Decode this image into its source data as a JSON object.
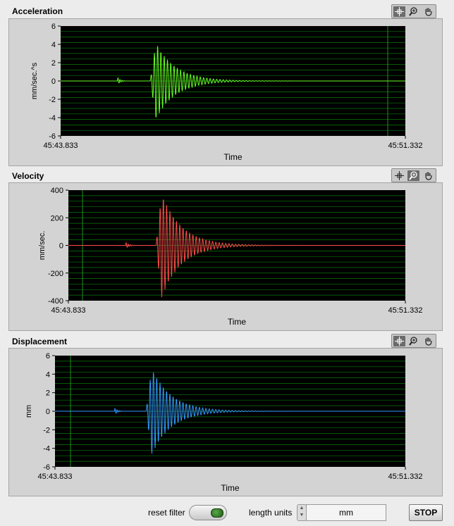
{
  "charts": [
    {
      "title": "Acceleration",
      "ylabel": "mm/sec.^s",
      "xlabel": "Time",
      "x_start": "45:43.833",
      "x_end": "45:51.332",
      "y_ticks": [
        "6",
        "4",
        "2",
        "0",
        "-2",
        "-4",
        "-6"
      ],
      "trace_color": "#66ff22",
      "cursor": true,
      "toolbar_active": "cursor-tool"
    },
    {
      "title": "Velocity",
      "ylabel": "mm/sec.",
      "xlabel": "Time",
      "x_start": "45:43.833",
      "x_end": "45:51.332",
      "y_ticks": [
        "400",
        "200",
        "0",
        "-200",
        "-400"
      ],
      "trace_color": "#ff4a4a",
      "cursor": true,
      "toolbar_active": "zoom-tool"
    },
    {
      "title": "Displacement",
      "ylabel": "mm",
      "xlabel": "Time",
      "x_start": "45:43.833",
      "x_end": "45:51.332",
      "y_ticks": [
        "6",
        "4",
        "2",
        "0",
        "-2",
        "-4",
        "-6"
      ],
      "trace_color": "#3399ff",
      "cursor": true,
      "toolbar_active": "cursor-tool"
    }
  ],
  "controls": {
    "reset_filter_label": "reset filter",
    "length_units_label": "length units",
    "length_units_value": "mm",
    "stop_label": "STOP"
  },
  "chart_data": [
    {
      "type": "line",
      "title": "Acceleration",
      "xlabel": "Time",
      "ylabel": "mm/sec.^s",
      "x_range": [
        "45:43.833",
        "45:51.332"
      ],
      "ylim": [
        -6,
        6
      ],
      "series": [
        {
          "values_description_peak": 4.2,
          "trough": -5.0
        }
      ]
    },
    {
      "type": "line",
      "title": "Velocity",
      "xlabel": "Time",
      "ylabel": "mm/sec.",
      "x_range": [
        "45:43.833",
        "45:51.332"
      ],
      "ylim": [
        -400,
        400
      ],
      "series": [
        {
          "values_description_peak": 380,
          "trough": -340
        }
      ]
    },
    {
      "type": "line",
      "title": "Displacement",
      "xlabel": "Time",
      "ylabel": "mm",
      "x_range": [
        "45:43.833",
        "45:51.332"
      ],
      "ylim": [
        -6,
        6
      ],
      "series": [
        {
          "values_description_peak": 4.7,
          "trough": -4.8
        }
      ]
    }
  ]
}
